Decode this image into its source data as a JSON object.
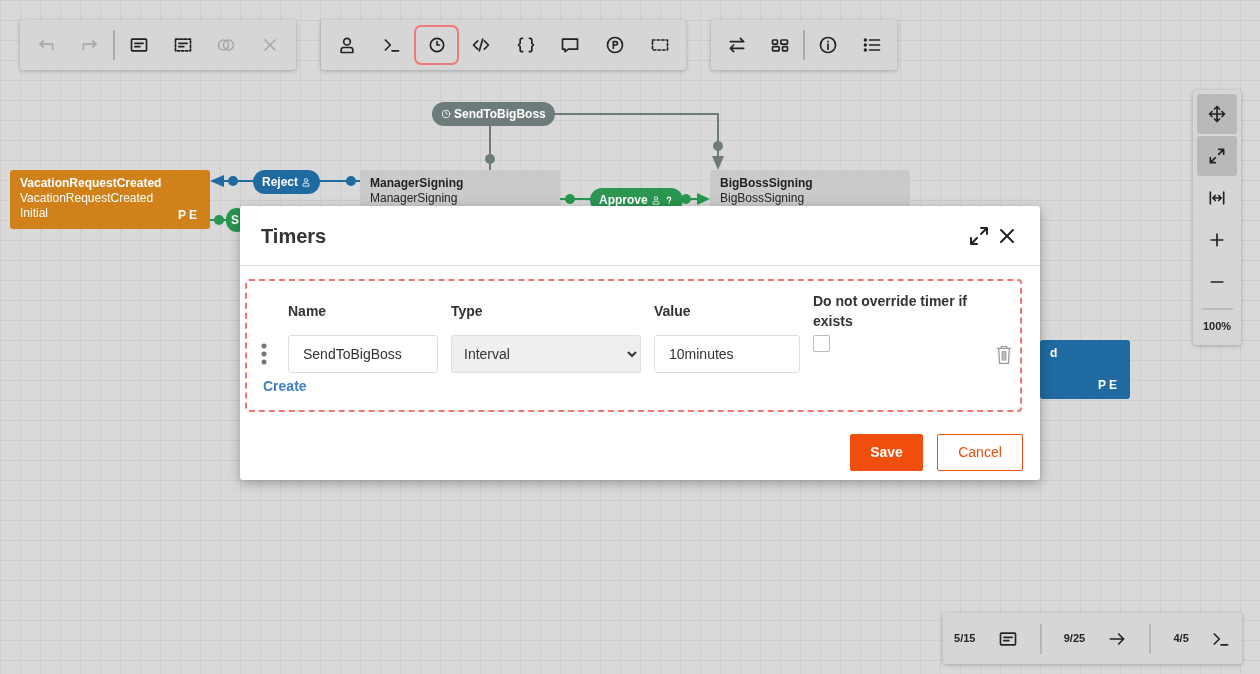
{
  "toolbars": [
    {
      "groups": [
        [
          {
            "disabled": true,
            "selected": false
          },
          {
            "disabled": true,
            "selected": false
          }
        ],
        [
          {
            "disabled": false,
            "selected": false
          },
          {
            "disabled": false,
            "selected": false
          },
          {
            "disabled": true,
            "selected": false
          },
          {
            "disabled": true,
            "selected": false
          }
        ]
      ]
    },
    {
      "groups": [
        [
          {
            "disabled": false,
            "selected": false
          },
          {
            "disabled": false,
            "selected": false
          },
          {
            "disabled": false,
            "selected": true
          },
          {
            "disabled": false,
            "selected": false
          },
          {
            "disabled": false,
            "selected": false
          },
          {
            "disabled": false,
            "selected": false
          },
          {
            "disabled": false,
            "selected": false
          },
          {
            "disabled": false,
            "selected": false
          }
        ]
      ]
    },
    {
      "groups": [
        [
          {
            "disabled": false,
            "selected": false
          },
          {
            "disabled": false,
            "selected": false
          }
        ],
        [
          {
            "disabled": false,
            "selected": false
          },
          {
            "disabled": false,
            "selected": false
          }
        ]
      ]
    }
  ],
  "diagram": {
    "nodes": [
      {
        "title": "VacationRequestCreated",
        "subtitle": "VacationRequestCreated",
        "state": "Initial",
        "badge": "PE",
        "color": "#d0811a"
      },
      {
        "title": "ManagerSigning",
        "subtitle": "ManagerSigning",
        "color": "#c8cacb"
      },
      {
        "title": "BigBossSigning",
        "subtitle": "BigBossSigning",
        "color": "#c8cacb"
      },
      {
        "title": "d",
        "badge": "PE",
        "color": "#1f6aa0"
      }
    ],
    "transitions": [
      {
        "label": "SendToBigBoss",
        "kind": "timer",
        "color": "#6e7b7b"
      },
      {
        "label": "Reject",
        "kind": "user",
        "color": "#1f6aa0"
      },
      {
        "label": "Approve",
        "kind": "user-condition",
        "color": "#2a9650"
      },
      {
        "label": "S",
        "kind": "plain",
        "color": "#2a9650"
      }
    ]
  },
  "zoom_panel": {
    "tools": [
      {
        "selected": true
      },
      {
        "selected": true
      },
      {
        "selected": false
      },
      {
        "selected": false
      },
      {
        "selected": false
      }
    ],
    "zoom": "100%"
  },
  "status_panel": {
    "counters": [
      "5/15",
      "9/25",
      "4/5"
    ]
  },
  "dialog": {
    "title": "Timers",
    "columns": [
      "Name",
      "Type",
      "Value",
      "Do not override timer if exists"
    ],
    "timers": [
      {
        "name": "SendToBigBoss",
        "type": "Interval",
        "value": "10minutes",
        "checked": false
      }
    ],
    "create_link": "Create",
    "buttons": [
      "Save",
      "Cancel"
    ]
  }
}
